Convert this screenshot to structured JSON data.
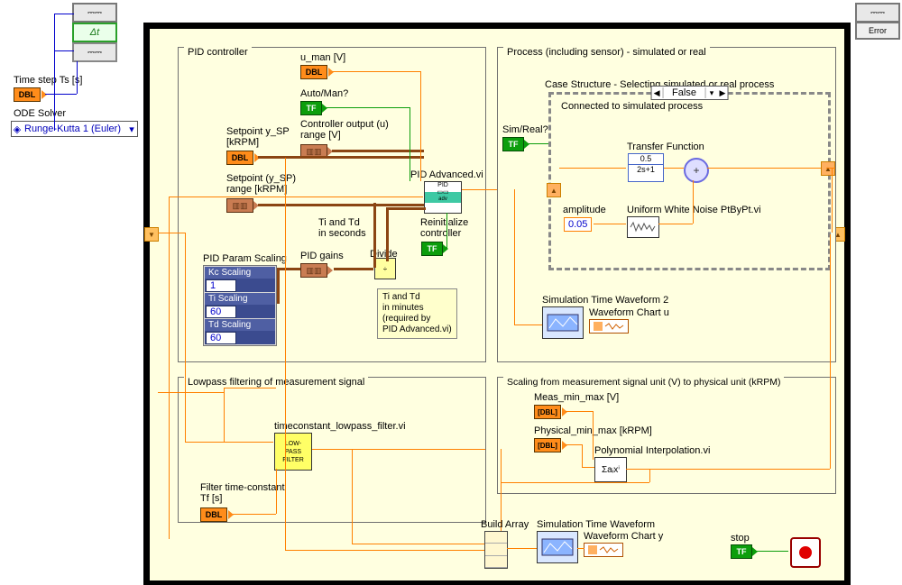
{
  "outer": {
    "time_step_label": "Time step Ts [s]",
    "dbl_text": "DBL",
    "ode_solver_label": "ODE Solver",
    "ode_solver_selected": "Runge-Kutta 1 (Euler)",
    "delta_t": "Δt",
    "error_label": "Error"
  },
  "pid": {
    "frame_title": "PID controller",
    "u_man_label": "u_man [V]",
    "auto_man_label": "Auto/Man?",
    "ctrl_out_label": "Controller output (u)\nrange [V]",
    "setpoint_lbl": "Setpoint y_SP\n[kRPM]",
    "setpoint_range_lbl": "Setpoint (y_SP)\nrange [kRPM]",
    "pid_vi_label": "PID Advanced.vi",
    "reinit_label": "Reinitialize\ncontroller",
    "pid_gains_label": "PID gains",
    "divide_label": "Divide",
    "ti_td_sec_label": "Ti and Td\nin seconds",
    "ti_td_tooltip": "Ti and Td\nin minutes\n(required by\nPID Advanced.vi)",
    "scaling": {
      "title": "PID Param Scaling",
      "rows": [
        {
          "label": "Kc Scaling",
          "value": "1"
        },
        {
          "label": "Ti Scaling",
          "value": "60"
        },
        {
          "label": "Td Scaling",
          "value": "60"
        }
      ]
    }
  },
  "process": {
    "frame_title": "Process (including sensor) - simulated or real",
    "case_title": "Case Structure - Selecting simulated or real process",
    "case_value": "False",
    "sim_real_label": "Sim/Real?",
    "connected_label": "Connected to simulated process",
    "transfer_fn_label": "Transfer Function",
    "transfer_fn_expr_num": "0.5",
    "transfer_fn_expr_den": "2s+1",
    "noise_vi_label": "Uniform White Noise PtByPt.vi",
    "amplitude_label": "amplitude",
    "amplitude_value": "0.05",
    "sim_time_wave2_label": "Simulation Time Waveform 2",
    "waveform_chart_u_label": "Waveform Chart u"
  },
  "lowpass": {
    "frame_title": "Lowpass filtering of measurement signal",
    "vi_label": "timeconstant_lowpass_filter.vi",
    "vi_node_text": "LOW-\nPASS\nFILTER",
    "tf_label": "Filter time-constant\nTf [s]"
  },
  "scaling_frame": {
    "frame_title": "Scaling from measurement signal unit (V) to physical unit (kRPM)",
    "meas_label": "Meas_min_max [V]",
    "phys_label": "Physical_min_max [kRPM]",
    "poly_label": "Polynomial Interpolation.vi",
    "poly_glyph": "Σaᵢxⁱ"
  },
  "bottom": {
    "build_array_label": "Build Array",
    "sim_time_wave_label": "Simulation Time Waveform",
    "waveform_chart_y_label": "Waveform Chart y",
    "stop_label": "stop"
  },
  "tf_text": "TF"
}
